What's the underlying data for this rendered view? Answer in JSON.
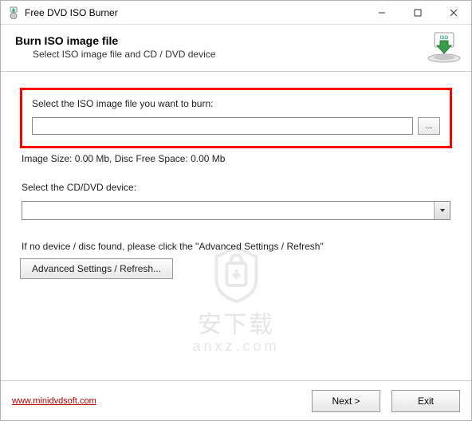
{
  "titlebar": {
    "app_name": "Free DVD ISO Burner"
  },
  "header": {
    "title": "Burn ISO image file",
    "subtitle": "Select ISO image file and CD / DVD device"
  },
  "iso": {
    "label": "Select the ISO image file you want to burn:",
    "path_value": "",
    "browse_label": "...",
    "info": "Image Size: 0.00 Mb, Disc Free Space: 0.00 Mb"
  },
  "device": {
    "label": "Select the CD/DVD device:",
    "selected": ""
  },
  "advanced": {
    "hint": "If no device / disc found, please click the \"Advanced Settings / Refresh\"",
    "button": "Advanced Settings / Refresh..."
  },
  "footer": {
    "link": "www.minidvdsoft.com",
    "next": "Next >",
    "exit": "Exit"
  },
  "watermark": {
    "line1": "安下载",
    "line2": "anxz.com"
  }
}
